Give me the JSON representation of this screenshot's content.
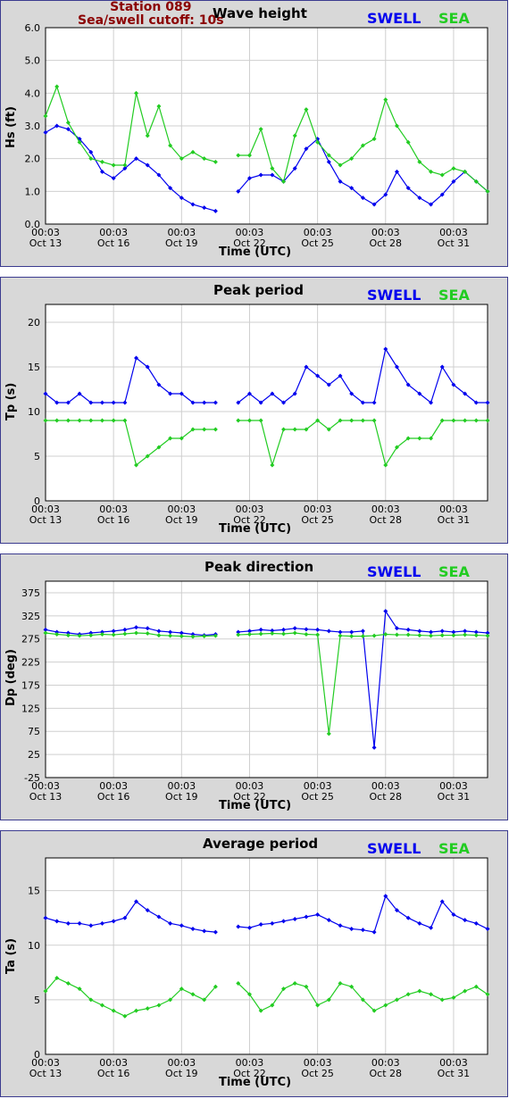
{
  "header": {
    "station": "Station 089",
    "cutoff": "Sea/swell cutoff: 10s"
  },
  "legend": {
    "swell": "SWELL",
    "sea": "SEA"
  },
  "colors": {
    "swell": "#0000ee",
    "sea": "#22cc22",
    "panel_bg": "#d8d8d8",
    "border": "#3b3b8f"
  },
  "x_ticks": {
    "times": [
      "00:03",
      "00:03",
      "00:03",
      "00:03",
      "00:03",
      "00:03",
      "00:03"
    ],
    "dates": [
      "Oct 13",
      "Oct 16",
      "Oct 19",
      "Oct 22",
      "Oct 25",
      "Oct 28",
      "Oct 31"
    ]
  },
  "chart_data": [
    {
      "type": "line",
      "title": "Wave height",
      "xlabel": "Time (UTC)",
      "ylabel": "Hs (ft)",
      "ylim": [
        0,
        6
      ],
      "yticks": [
        "0.0",
        "1.0",
        "2.0",
        "3.0",
        "4.0",
        "5.0",
        "6.0"
      ],
      "ytick_values": [
        0,
        1,
        2,
        3,
        4,
        5,
        6
      ],
      "x": [
        0,
        0.5,
        1,
        1.5,
        2,
        2.5,
        3,
        3.5,
        4,
        4.5,
        5,
        5.5,
        6,
        6.5,
        7,
        7.5,
        8,
        8.5,
        9,
        9.5,
        10,
        10.5,
        11,
        11.5,
        12,
        12.5,
        13,
        13.5,
        14,
        14.5,
        15,
        15.5,
        16,
        16.5,
        17,
        17.5,
        18,
        18.5,
        19,
        19.5
      ],
      "series": [
        {
          "name": "SWELL",
          "values": [
            2.8,
            3.0,
            2.9,
            2.6,
            2.2,
            1.6,
            1.4,
            1.7,
            2.0,
            1.8,
            1.5,
            1.1,
            0.8,
            0.6,
            0.5,
            0.4,
            null,
            1.0,
            1.4,
            1.5,
            1.5,
            1.3,
            1.7,
            2.3,
            2.6,
            1.9,
            1.3,
            1.1,
            0.8,
            0.6,
            0.9,
            1.6,
            1.1,
            0.8,
            0.6,
            0.9,
            1.3,
            1.6,
            1.3,
            1.0
          ]
        },
        {
          "name": "SEA",
          "values": [
            3.3,
            4.2,
            3.1,
            2.5,
            2.0,
            1.9,
            1.8,
            1.8,
            4.0,
            2.7,
            3.6,
            2.4,
            2.0,
            2.2,
            2.0,
            1.9,
            null,
            2.1,
            2.1,
            2.9,
            1.7,
            1.3,
            2.7,
            3.5,
            2.5,
            2.1,
            1.8,
            2.0,
            2.4,
            2.6,
            3.8,
            3.0,
            2.5,
            1.9,
            1.6,
            1.5,
            1.7,
            1.6,
            1.3,
            1.0
          ]
        }
      ]
    },
    {
      "type": "line",
      "title": "Peak period",
      "xlabel": "Time (UTC)",
      "ylabel": "Tp (s)",
      "ylim": [
        0,
        22
      ],
      "yticks": [
        "0",
        "5",
        "10",
        "15",
        "20"
      ],
      "ytick_values": [
        0,
        5,
        10,
        15,
        20
      ],
      "x": [
        0,
        0.5,
        1,
        1.5,
        2,
        2.5,
        3,
        3.5,
        4,
        4.5,
        5,
        5.5,
        6,
        6.5,
        7,
        7.5,
        8,
        8.5,
        9,
        9.5,
        10,
        10.5,
        11,
        11.5,
        12,
        12.5,
        13,
        13.5,
        14,
        14.5,
        15,
        15.5,
        16,
        16.5,
        17,
        17.5,
        18,
        18.5,
        19,
        19.5
      ],
      "series": [
        {
          "name": "SWELL",
          "values": [
            12,
            11,
            11,
            12,
            11,
            11,
            11,
            11,
            16,
            15,
            13,
            12,
            12,
            11,
            11,
            11,
            null,
            11,
            12,
            11,
            12,
            11,
            12,
            15,
            14,
            13,
            14,
            12,
            11,
            11,
            17,
            15,
            13,
            12,
            11,
            15,
            13,
            12,
            11,
            11
          ]
        },
        {
          "name": "SEA",
          "values": [
            9,
            9,
            9,
            9,
            9,
            9,
            9,
            9,
            4,
            5,
            6,
            7,
            7,
            8,
            8,
            8,
            null,
            9,
            9,
            9,
            4,
            8,
            8,
            8,
            9,
            8,
            9,
            9,
            9,
            9,
            4,
            6,
            7,
            7,
            7,
            9,
            9,
            9,
            9,
            9
          ]
        }
      ]
    },
    {
      "type": "line",
      "title": "Peak direction",
      "xlabel": "Time (UTC)",
      "ylabel": "Dp (deg)",
      "ylim": [
        -25,
        400
      ],
      "yticks": [
        "-25",
        "25",
        "75",
        "125",
        "175",
        "225",
        "275",
        "325",
        "375"
      ],
      "ytick_values": [
        -25,
        25,
        75,
        125,
        175,
        225,
        275,
        325,
        375
      ],
      "x": [
        0,
        0.5,
        1,
        1.5,
        2,
        2.5,
        3,
        3.5,
        4,
        4.5,
        5,
        5.5,
        6,
        6.5,
        7,
        7.5,
        8,
        8.5,
        9,
        9.5,
        10,
        10.5,
        11,
        11.5,
        12,
        12.5,
        13,
        13.5,
        14,
        14.5,
        15,
        15.5,
        16,
        16.5,
        17,
        17.5,
        18,
        18.5,
        19,
        19.5
      ],
      "series": [
        {
          "name": "SWELL",
          "values": [
            295,
            290,
            288,
            285,
            288,
            290,
            292,
            295,
            300,
            298,
            292,
            290,
            288,
            285,
            283,
            285,
            null,
            290,
            292,
            295,
            293,
            295,
            298,
            296,
            295,
            292,
            290,
            290,
            292,
            40,
            335,
            298,
            295,
            292,
            290,
            292,
            290,
            292,
            290,
            288
          ]
        },
        {
          "name": "SEA",
          "values": [
            288,
            285,
            283,
            282,
            283,
            285,
            284,
            286,
            288,
            287,
            283,
            282,
            281,
            280,
            281,
            282,
            null,
            284,
            285,
            286,
            287,
            286,
            288,
            285,
            284,
            70,
            282,
            281,
            281,
            282,
            285,
            284,
            284,
            283,
            282,
            283,
            283,
            284,
            283,
            282
          ]
        }
      ]
    },
    {
      "type": "line",
      "title": "Average period",
      "xlabel": "Time (UTC)",
      "ylabel": "Ta (s)",
      "ylim": [
        0,
        18
      ],
      "yticks": [
        "0",
        "5",
        "10",
        "15"
      ],
      "ytick_values": [
        0,
        5,
        10,
        15
      ],
      "x": [
        0,
        0.5,
        1,
        1.5,
        2,
        2.5,
        3,
        3.5,
        4,
        4.5,
        5,
        5.5,
        6,
        6.5,
        7,
        7.5,
        8,
        8.5,
        9,
        9.5,
        10,
        10.5,
        11,
        11.5,
        12,
        12.5,
        13,
        13.5,
        14,
        14.5,
        15,
        15.5,
        16,
        16.5,
        17,
        17.5,
        18,
        18.5,
        19,
        19.5
      ],
      "series": [
        {
          "name": "SWELL",
          "values": [
            12.5,
            12.2,
            12.0,
            12.0,
            11.8,
            12.0,
            12.2,
            12.5,
            14.0,
            13.2,
            12.6,
            12.0,
            11.8,
            11.5,
            11.3,
            11.2,
            null,
            11.7,
            11.6,
            11.9,
            12.0,
            12.2,
            12.4,
            12.6,
            12.8,
            12.3,
            11.8,
            11.5,
            11.4,
            11.2,
            14.5,
            13.2,
            12.5,
            12.0,
            11.6,
            14.0,
            12.8,
            12.3,
            12.0,
            11.5
          ]
        },
        {
          "name": "SEA",
          "values": [
            5.8,
            7.0,
            6.5,
            6.0,
            5.0,
            4.5,
            4.0,
            3.5,
            4.0,
            4.2,
            4.5,
            5.0,
            6.0,
            5.5,
            5.0,
            6.2,
            null,
            6.5,
            5.5,
            4.0,
            4.5,
            6.0,
            6.5,
            6.2,
            4.5,
            5.0,
            6.5,
            6.2,
            5.0,
            4.0,
            4.5,
            5.0,
            5.5,
            5.8,
            5.5,
            5.0,
            5.2,
            5.8,
            6.2,
            5.5
          ]
        }
      ]
    }
  ]
}
